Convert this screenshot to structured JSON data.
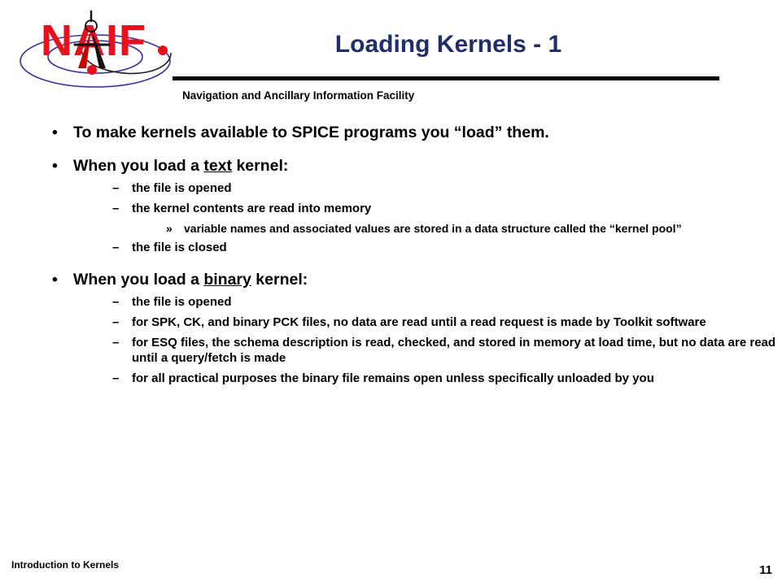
{
  "header": {
    "title": "Loading Kernels - 1",
    "subtitle": "Navigation and Ancillary Information Facility",
    "title_color": "#1f2f6b",
    "logo": {
      "wordmark": "NAIF",
      "wordmark_color": "#e8101a",
      "orbit_color": "#3333a8",
      "compass_color": "#cc0000",
      "dot_color": "#e8101a"
    }
  },
  "content": {
    "bullets": [
      {
        "level": 1,
        "marker": "•",
        "parts": [
          {
            "text": "To make kernels available to SPICE programs you “load” them."
          }
        ]
      },
      {
        "level": 1,
        "marker": "•",
        "parts": [
          {
            "text": "When you load a "
          },
          {
            "text": "text",
            "underline": true
          },
          {
            "text": " kernel:"
          }
        ],
        "children": [
          {
            "level": 2,
            "marker": "–",
            "parts": [
              {
                "text": "the file is opened"
              }
            ]
          },
          {
            "level": 2,
            "marker": "–",
            "parts": [
              {
                "text": "the kernel contents are read into memory"
              }
            ],
            "children": [
              {
                "level": 3,
                "marker": "»",
                "parts": [
                  {
                    "text": "variable names and associated values are stored in a data structure called the “kernel pool”"
                  }
                ]
              }
            ]
          },
          {
            "level": 2,
            "marker": "–",
            "parts": [
              {
                "text": "the file is closed"
              }
            ]
          }
        ]
      },
      {
        "level": 1,
        "marker": "•",
        "parts": [
          {
            "text": "When you load a "
          },
          {
            "text": "binary",
            "underline": true
          },
          {
            "text": " kernel:"
          }
        ],
        "children": [
          {
            "level": 2,
            "marker": "–",
            "parts": [
              {
                "text": "the file is opened"
              }
            ]
          },
          {
            "level": 2,
            "marker": "–",
            "parts": [
              {
                "text": "for SPK, CK, and binary PCK files, no data are read until a read request is made by Toolkit software"
              }
            ]
          },
          {
            "level": 2,
            "marker": "–",
            "parts": [
              {
                "text": "for ESQ files, the schema description is read, checked, and stored in memory at load time, but no data are read until a query/fetch is made"
              }
            ]
          },
          {
            "level": 2,
            "marker": "–",
            "parts": [
              {
                "text": "for all practical purposes the binary file remains open unless specifically unloaded by you"
              }
            ]
          }
        ]
      }
    ]
  },
  "footer": {
    "label": "Introduction to Kernels",
    "page_number": "11"
  }
}
